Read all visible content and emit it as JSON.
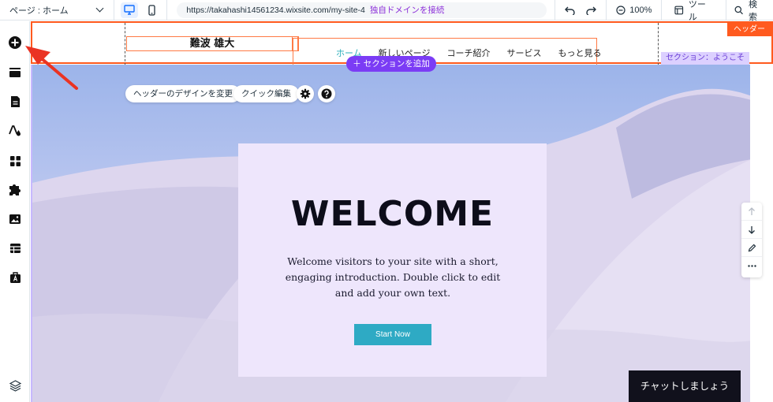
{
  "topbar": {
    "page_selector": "ページ : ホーム",
    "url": "https://takahashi14561234.wixsite.com/my-site-4",
    "connect_domain": "独自ドメインを接続",
    "zoom": "100%",
    "tools": "ツール",
    "search": "検索"
  },
  "sidebar": {
    "items": [
      "plus-circle-icon",
      "sections-icon",
      "pages-icon",
      "design-icon",
      "add-apps-icon",
      "puzzle-icon",
      "media-icon",
      "table-icon",
      "business-icon"
    ],
    "bottom": "layers-icon"
  },
  "header": {
    "logo_text": "難波 雄大",
    "menu": [
      "ホーム",
      "新しいページ",
      "コーチ紹介",
      "サービス",
      "もっと見る"
    ],
    "header_tag": "ヘッダー",
    "section_tag": "セクション：ようこそ",
    "add_section": "＋ セクションを追加"
  },
  "hero": {
    "change_header_design": "ヘッダーのデザインを変更",
    "quick_edit": "クイック編集",
    "title": "WELCOME",
    "text": "Welcome visitors to your site with a short, engaging introduction. Double click to edit and add your own text.",
    "button": "Start Now",
    "chat": "チャットしましょう"
  },
  "colors": {
    "accent": "#7b3cf5",
    "header_border": "#ff5a1f",
    "menu_active": "#2aaeba",
    "button": "#2eaac4",
    "arrow": "#ea3323"
  }
}
